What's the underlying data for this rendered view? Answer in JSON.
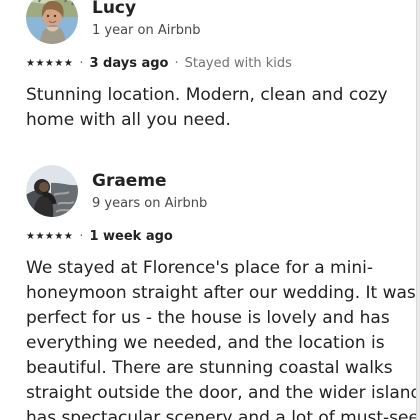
{
  "reviews": [
    {
      "name": "Lucy",
      "tenure": "1 year on Airbnb",
      "stars": "★★★★★",
      "separator": "·",
      "date": "3 days ago",
      "trip_type": "Stayed with kids",
      "text_lines": [
        "Stunning location. Modern, clean and cozy",
        "home with all you need."
      ],
      "avatar_icon": "reviewer-photo"
    },
    {
      "name": "Graeme",
      "tenure": "9 years on Airbnb",
      "stars": "★★★★★",
      "separator": "·",
      "date": "1 week ago",
      "text_lines": [
        "We stayed at Florence's place for a mini-",
        "honeymoon straight after our wedding. It was",
        "perfect for us - the house is lovely and has",
        "everything we needed, and the location is",
        "beautiful. There are stunning coastal walks",
        "straight outside the door, and the wider island",
        "has spectacular scenery and a lot of must-see"
      ],
      "avatar_icon": "reviewer-photo"
    }
  ],
  "colors": {
    "text": "#222222",
    "secondary_text": "#717171",
    "background": "#ffffff"
  }
}
